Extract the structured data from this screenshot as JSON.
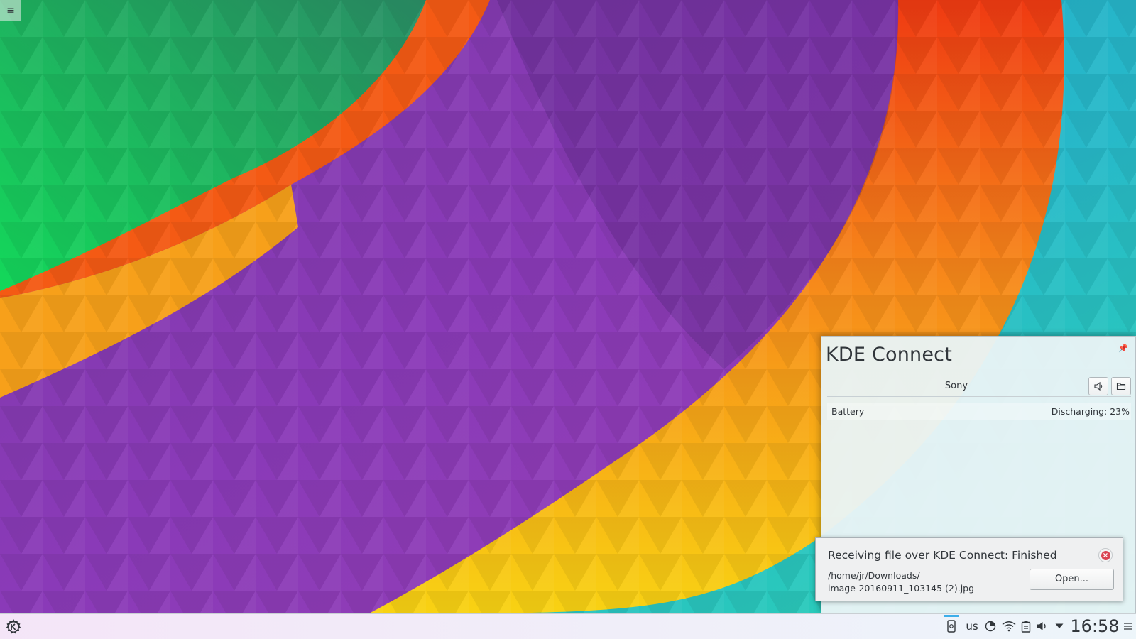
{
  "kdeconnect": {
    "title": "KDE Connect",
    "device_name": "Sony",
    "battery_label": "Battery",
    "battery_status": "Discharging: 23%"
  },
  "notification": {
    "title": "Receiving file over KDE Connect: Finished",
    "path_line1": "/home/jr/Downloads/",
    "path_line2": "image-20160911_103145 (2).jpg",
    "open_label": "Open..."
  },
  "taskbar": {
    "keyboard_layout": "us",
    "clock": "16:58"
  },
  "icons": {
    "desktop_toolbox": "hamburger-menu-icon",
    "pin": "pin-icon",
    "ring": "speaker-icon",
    "browse": "folder-icon",
    "close": "close-icon",
    "launcher": "kde-logo-icon"
  },
  "colors": {
    "accent": "#3daee9",
    "close_red": "#da4453",
    "popup_bg": "#e9f4f6"
  }
}
